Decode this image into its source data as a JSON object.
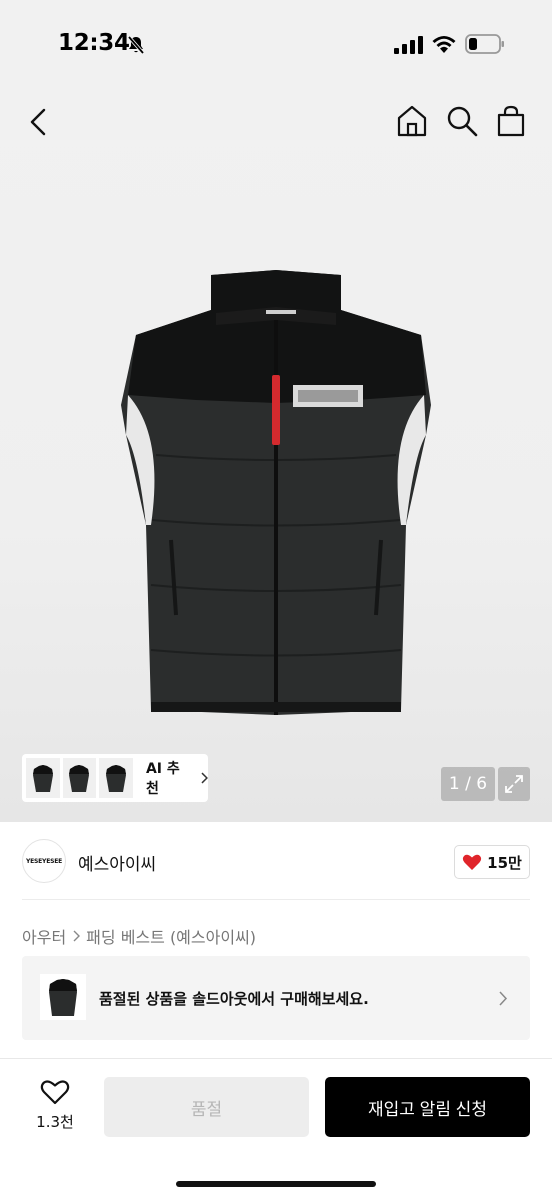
{
  "status_bar": {
    "time": "12:34",
    "icons": [
      "bell-slash-icon",
      "signal-icon",
      "wifi-icon",
      "battery-icon"
    ]
  },
  "nav": {
    "icons": [
      "back-icon",
      "home-icon",
      "search-icon",
      "shopping-bag-icon"
    ]
  },
  "product_image": {
    "alt_icon": "vest-product-image",
    "ai_recommend_label": "AI 추천",
    "page_counter": "1 / 6"
  },
  "brand": {
    "logo_text": "YESEYESEE",
    "name": "예스아이씨",
    "like_count": "15만"
  },
  "breadcrumb": {
    "items": [
      "아우터",
      "패딩 베스트 (예스아이씨)"
    ]
  },
  "soldout_banner": {
    "text": "품절된 상품을 솔드아웃에서 구매해보세요."
  },
  "bottom_bar": {
    "wish_count": "1.3천",
    "soldout_label": "품절",
    "restock_label": "재입고 알림 신청"
  },
  "colors": {
    "accent_red": "#e0252b",
    "primary_button": "#000000",
    "disabled_button": "#ededed"
  }
}
